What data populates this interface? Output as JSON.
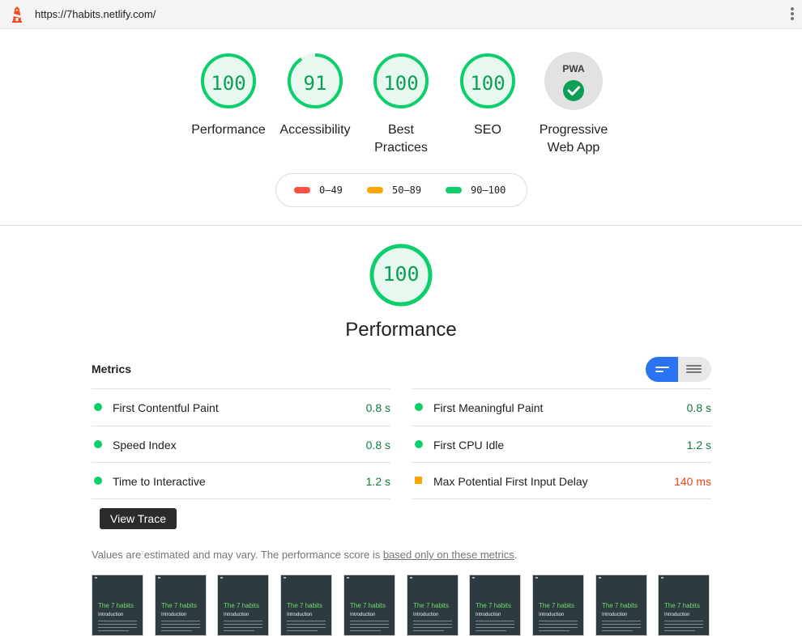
{
  "browser": {
    "url": "https://7habits.netlify.com/",
    "logo_icon": "lighthouse-icon",
    "menu_icon": "kebab-menu-icon"
  },
  "colors": {
    "pass": "#0cce6b",
    "pass_text": "#0c9f55",
    "average": "#ffa400",
    "fail": "#ff4e42",
    "accent": "#2a73f4"
  },
  "categories": [
    {
      "id": "performance",
      "score": "100",
      "fraction": 1.0,
      "label": "Performance"
    },
    {
      "id": "accessibility",
      "score": "91",
      "fraction": 0.91,
      "label": "Accessibility"
    },
    {
      "id": "best-practices",
      "score": "100",
      "fraction": 1.0,
      "label": "Best Practices"
    },
    {
      "id": "seo",
      "score": "100",
      "fraction": 1.0,
      "label": "SEO"
    }
  ],
  "pwa": {
    "badge_text": "PWA",
    "label": "Progressive Web App",
    "icon": "check-icon"
  },
  "legend": [
    {
      "range": "0–49",
      "color": "#ff4e42"
    },
    {
      "range": "50–89",
      "color": "#ffa400"
    },
    {
      "range": "90–100",
      "color": "#0cce6b"
    }
  ],
  "performance": {
    "score": "100",
    "title": "Performance",
    "metrics_heading": "Metrics",
    "metrics": [
      {
        "label": "First Contentful Paint",
        "value": "0.8 s",
        "status": "pass"
      },
      {
        "label": "First Meaningful Paint",
        "value": "0.8 s",
        "status": "pass"
      },
      {
        "label": "Speed Index",
        "value": "0.8 s",
        "status": "pass"
      },
      {
        "label": "First CPU Idle",
        "value": "1.2 s",
        "status": "pass"
      },
      {
        "label": "Time to Interactive",
        "value": "1.2 s",
        "status": "pass"
      },
      {
        "label": "Max Potential First Input Delay",
        "value": "140 ms",
        "status": "average"
      }
    ],
    "view_trace_label": "View Trace",
    "note_text": "Values are estimated and may vary. The performance score is ",
    "note_link": "based only on these metrics",
    "note_end": "."
  },
  "filmstrip": {
    "frame_count": 10,
    "frame_title": "The 7 habits",
    "frame_subtitle": "Introduction"
  }
}
